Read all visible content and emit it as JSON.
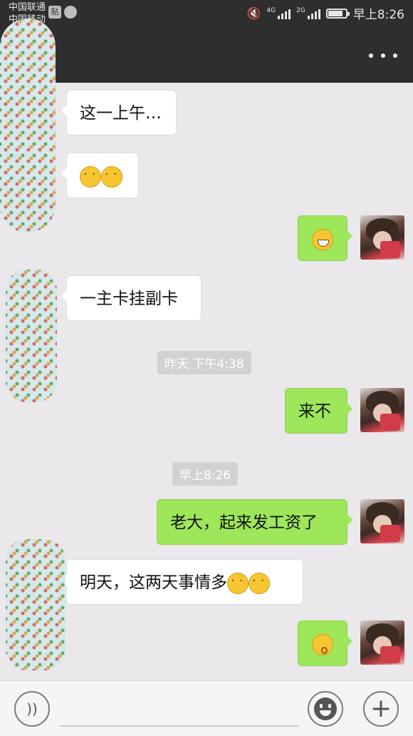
{
  "status_bar": {
    "carrier_1": "中国联通",
    "carrier_2": "中国移动",
    "notif_badge": "贴",
    "signal_1_label": "4G",
    "signal_2_label": "2G",
    "time": "早上8:26",
    "battery_level": 0.85
  },
  "header": {
    "more_icon": "more-dots-icon"
  },
  "messages": [
    {
      "side": "in",
      "text": "这一上午…"
    },
    {
      "side": "in",
      "emojis": [
        "lol",
        "lol"
      ]
    },
    {
      "side": "out",
      "emojis": [
        "grin"
      ]
    },
    {
      "side": "in",
      "text": "一主卡挂副卡"
    },
    {
      "type": "timestamp",
      "text": "昨天 下午4:38"
    },
    {
      "side": "out",
      "text": "来不"
    },
    {
      "type": "timestamp",
      "text": "早上8:26"
    },
    {
      "side": "out",
      "text": "老大，起来发工资了"
    },
    {
      "side": "in",
      "text": "明天，这两天事情多",
      "emojis": [
        "lol",
        "lol"
      ]
    },
    {
      "side": "out",
      "emojis": [
        "kiss"
      ]
    }
  ],
  "input_bar": {
    "voice_icon": "voice-icon",
    "sticker_icon": "sticker-icon",
    "plus_icon": "plus-icon",
    "plus_glyph": "+"
  }
}
